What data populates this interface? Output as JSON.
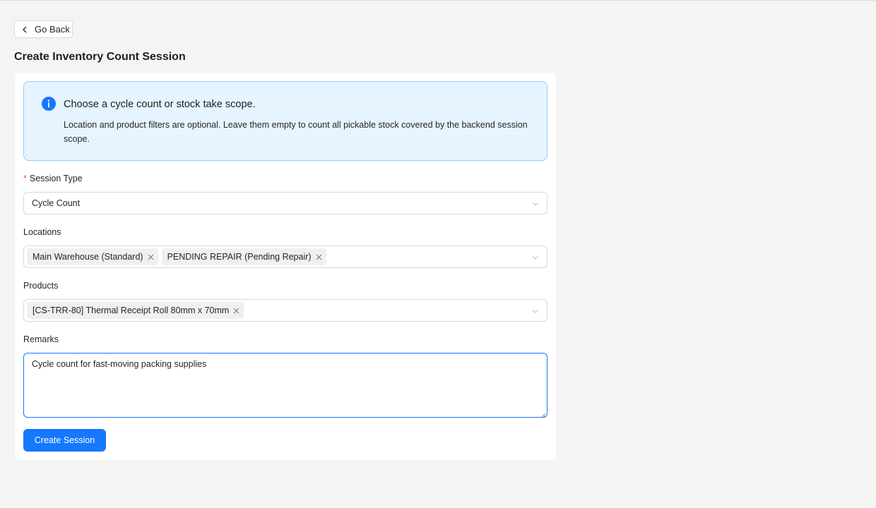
{
  "header": {
    "back_label": "Go Back",
    "page_title": "Create Inventory Count Session"
  },
  "alert": {
    "title": "Choose a cycle count or stock take scope.",
    "description": "Location and product filters are optional. Leave them empty to count all pickable stock covered by the backend session scope."
  },
  "form": {
    "session_type": {
      "label": "Session Type",
      "required_mark": "*",
      "value": "Cycle Count"
    },
    "locations": {
      "label": "Locations",
      "tags": [
        "Main Warehouse (Standard)",
        "PENDING REPAIR (Pending Repair)"
      ]
    },
    "products": {
      "label": "Products",
      "tags": [
        "[CS-TRR-80] Thermal Receipt Roll 80mm x 70mm"
      ]
    },
    "remarks": {
      "label": "Remarks",
      "value": "Cycle count for fast-moving packing supplies"
    },
    "submit_label": "Create Session"
  },
  "colors": {
    "primary": "#1677ff",
    "alert_bg": "#e6f4ff",
    "alert_border": "#91caff",
    "required": "#ff4d4f"
  },
  "icons": [
    "chevron-left-icon",
    "info-icon",
    "chevron-down-icon",
    "close-icon"
  ]
}
